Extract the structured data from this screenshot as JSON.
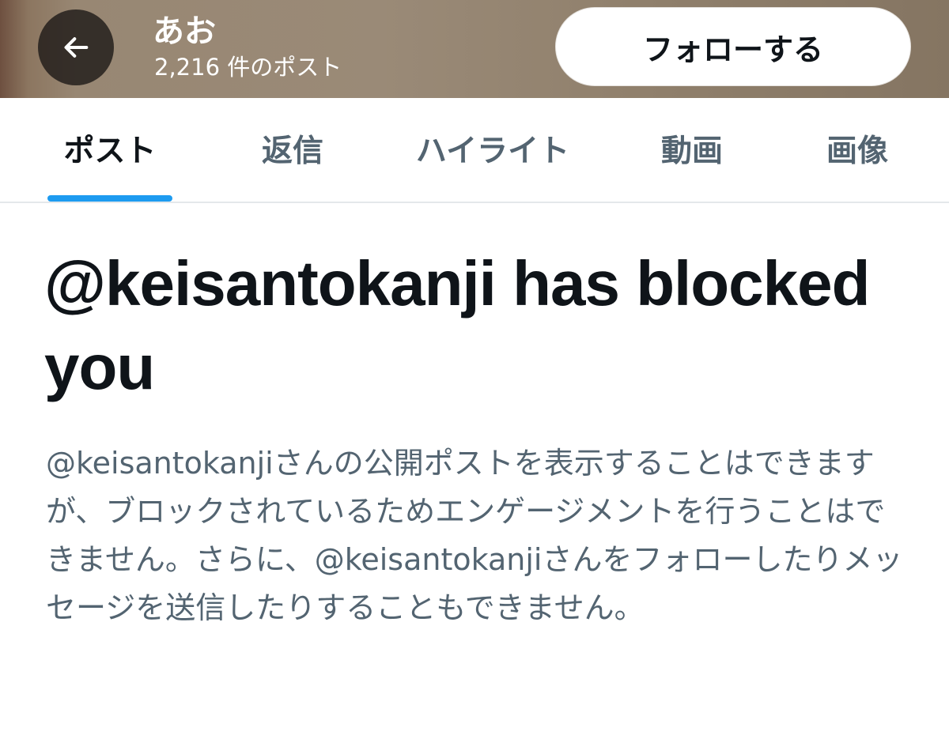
{
  "header": {
    "back_icon": "arrow-left-icon",
    "profile_name": "あお",
    "post_count": "2,216 件のポスト",
    "follow_label": "フォローする"
  },
  "tabs": [
    {
      "label": "ポスト",
      "active": true
    },
    {
      "label": "返信",
      "active": false
    },
    {
      "label": "ハイライト",
      "active": false
    },
    {
      "label": "動画",
      "active": false
    },
    {
      "label": "画像",
      "active": false
    }
  ],
  "notice": {
    "title": "@keisantokanji has blocked you",
    "description": "@keisantokanjiさんの公開ポストを表示することはできますが、ブロックされているためエンゲージメントを行うことはできません。さらに、@keisantokanjiさんをフォローしたりメッセージを送信したりすることもできません。"
  },
  "colors": {
    "accent": "#1d9bf0",
    "primary_text": "#0f1419",
    "secondary_text": "#536471"
  }
}
